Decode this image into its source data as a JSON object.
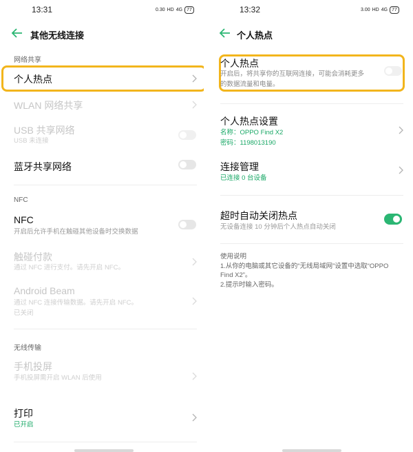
{
  "left": {
    "status_time": "13:31",
    "status_speed": "0.30",
    "status_hd": "HD",
    "status_net": "4G",
    "battery": "77",
    "title": "其他无线连接",
    "section_network_share": "网络共享",
    "hotspot_label": "个人热点",
    "wlan_share_label": "WLAN 网络共享",
    "usb_share_label": "USB 共享网络",
    "usb_share_sub": "USB 未连接",
    "bt_share_label": "蓝牙共享网络",
    "section_nfc": "NFC",
    "nfc_label": "NFC",
    "nfc_sub": "开启后允许手机在触碰其他设备时交换数据",
    "tap_pay_label": "触碰付款",
    "tap_pay_sub": "通过 NFC 进行支付。请先开启 NFC。",
    "beam_label": "Android Beam",
    "beam_sub1": "通过 NFC 连接传输数据。请先开启 NFC。",
    "beam_sub2": "已关闭",
    "section_wireless": "无线传输",
    "cast_label": "手机投屏",
    "cast_sub": "手机投屏需开启 WLAN 后使用",
    "print_label": "打印",
    "print_sub": "已开启"
  },
  "right": {
    "status_time": "13:32",
    "status_speed": "3.00",
    "status_hd": "HD",
    "status_net": "4G",
    "battery": "77",
    "title": "个人热点",
    "hotspot_label": "个人热点",
    "hotspot_desc1": "开启后，将共享你的互联网连接，可能会消耗更多",
    "hotspot_desc2": "的数据流量和电量。",
    "settings_label": "个人热点设置",
    "settings_name": "名称：OPPO Find X2",
    "settings_password": "密码：1198013190",
    "conn_label": "连接管理",
    "conn_sub": "已连接 0 台设备",
    "auto_off_label": "超时自动关闭热点",
    "auto_off_sub": "无设备连接 10 分钟后个人热点自动关闭",
    "usage_title": "使用说明",
    "usage_line1": "1.从你的电脑或其它设备的“无线局域网”设置中选取“OPPO",
    "usage_line2": "Find X2”。",
    "usage_line3": "2.提示时输入密码。"
  },
  "colors": {
    "accent_green": "#2bb673",
    "highlight": "#f2b51c"
  }
}
